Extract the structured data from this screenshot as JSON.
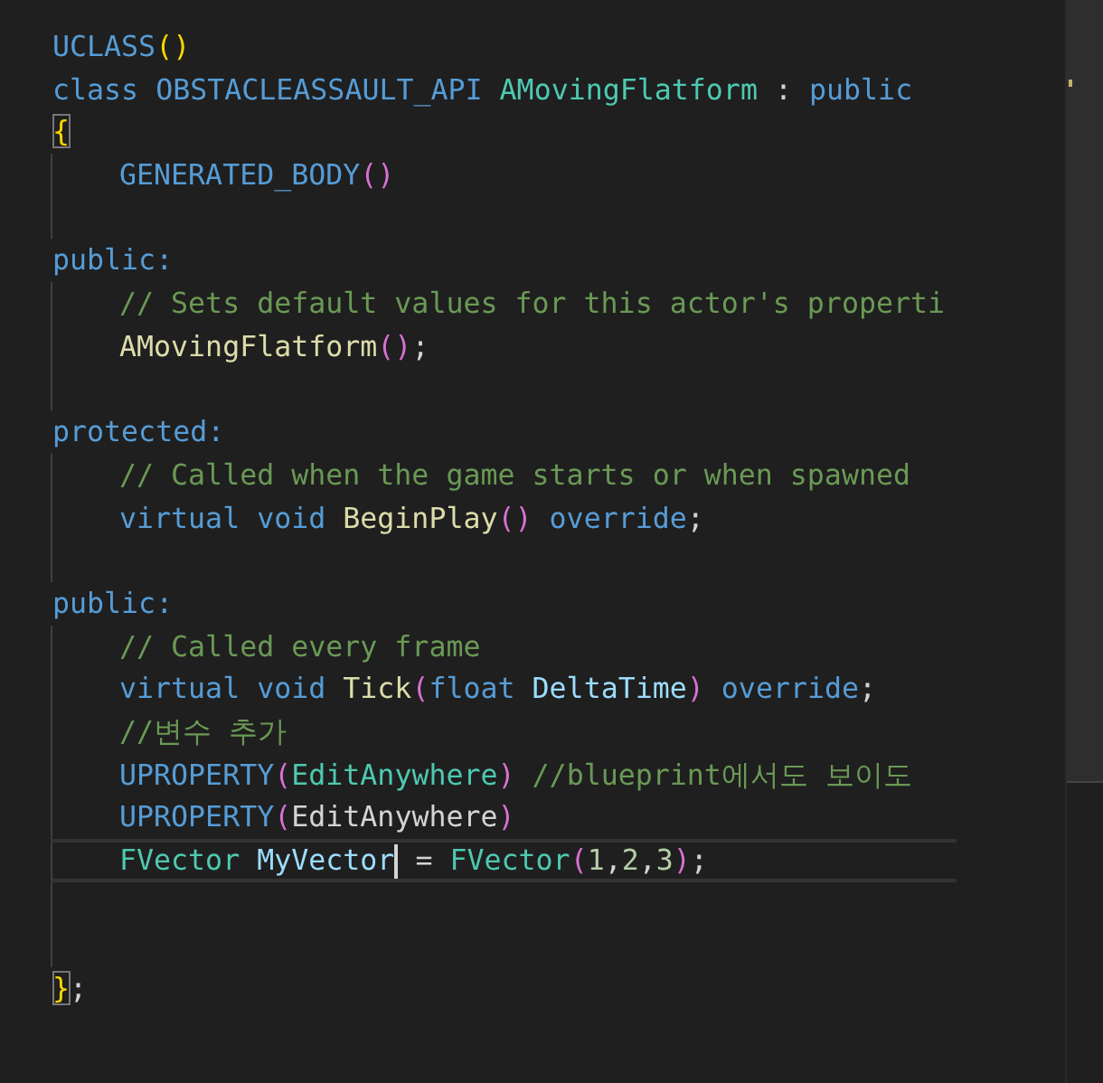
{
  "editor": {
    "lines": [
      {
        "in_block": false,
        "indented": false,
        "current": false,
        "tokens": [
          {
            "kind": "macro",
            "text": "UCLASS"
          },
          {
            "kind": "paren1",
            "text": "()"
          }
        ]
      },
      {
        "in_block": false,
        "indented": false,
        "current": false,
        "tokens": [
          {
            "kind": "keyword",
            "text": "class "
          },
          {
            "kind": "macro",
            "text": "OBSTACLEASSAULT_API "
          },
          {
            "kind": "type",
            "text": "AMovingFlatform"
          },
          {
            "kind": "plain",
            "text": " : "
          },
          {
            "kind": "keyword",
            "text": "public"
          }
        ]
      },
      {
        "in_block": false,
        "indented": false,
        "current": false,
        "tokens": [
          {
            "kind": "brace_match",
            "text": "{"
          }
        ]
      },
      {
        "in_block": true,
        "indented": true,
        "current": false,
        "tokens": [
          {
            "kind": "macro",
            "text": "GENERATED_BODY"
          },
          {
            "kind": "paren2",
            "text": "()"
          }
        ]
      },
      {
        "in_block": true,
        "indented": false,
        "current": false
      },
      {
        "in_block": false,
        "indented": false,
        "current": false,
        "tokens": [
          {
            "kind": "keyword",
            "text": "public:"
          }
        ]
      },
      {
        "in_block": true,
        "indented": true,
        "current": false,
        "tokens": [
          {
            "kind": "comment",
            "text": "// Sets default values for this actor's properti"
          }
        ]
      },
      {
        "in_block": true,
        "indented": true,
        "current": false,
        "tokens": [
          {
            "kind": "function",
            "text": "AMovingFlatform"
          },
          {
            "kind": "paren2",
            "text": "()"
          },
          {
            "kind": "plain",
            "text": ";"
          }
        ]
      },
      {
        "in_block": true,
        "indented": false,
        "current": false
      },
      {
        "in_block": false,
        "indented": false,
        "current": false,
        "tokens": [
          {
            "kind": "keyword",
            "text": "protected:"
          }
        ]
      },
      {
        "in_block": true,
        "indented": true,
        "current": false,
        "tokens": [
          {
            "kind": "comment",
            "text": "// Called when the game starts or when spawned"
          }
        ]
      },
      {
        "in_block": true,
        "indented": true,
        "current": false,
        "tokens": [
          {
            "kind": "keyword",
            "text": "virtual void "
          },
          {
            "kind": "function",
            "text": "BeginPlay"
          },
          {
            "kind": "paren2",
            "text": "()"
          },
          {
            "kind": "keyword",
            "text": " override"
          },
          {
            "kind": "plain",
            "text": ";"
          }
        ]
      },
      {
        "in_block": true,
        "indented": false,
        "current": false
      },
      {
        "in_block": false,
        "indented": false,
        "current": false,
        "tokens": [
          {
            "kind": "keyword",
            "text": "public:"
          }
        ]
      },
      {
        "in_block": true,
        "indented": true,
        "current": false,
        "tokens": [
          {
            "kind": "comment",
            "text": "// Called every frame"
          }
        ]
      },
      {
        "in_block": true,
        "indented": true,
        "current": false,
        "tokens": [
          {
            "kind": "keyword",
            "text": "virtual void "
          },
          {
            "kind": "function",
            "text": "Tick"
          },
          {
            "kind": "paren2",
            "text": "("
          },
          {
            "kind": "keyword",
            "text": "float "
          },
          {
            "kind": "param",
            "text": "DeltaTime"
          },
          {
            "kind": "paren2",
            "text": ")"
          },
          {
            "kind": "keyword",
            "text": " override"
          },
          {
            "kind": "plain",
            "text": ";"
          }
        ]
      },
      {
        "in_block": true,
        "indented": true,
        "current": false,
        "tokens": [
          {
            "kind": "comment",
            "text": "//변수 추가"
          }
        ]
      },
      {
        "in_block": true,
        "indented": true,
        "current": false,
        "tokens": [
          {
            "kind": "macro",
            "text": "UPROPERTY"
          },
          {
            "kind": "paren2",
            "text": "("
          },
          {
            "kind": "type",
            "text": "EditAnywhere"
          },
          {
            "kind": "paren2",
            "text": ")"
          },
          {
            "kind": "comment",
            "text": " //blueprint에서도 보이도"
          }
        ]
      },
      {
        "in_block": true,
        "indented": true,
        "current": false,
        "tokens": [
          {
            "kind": "macro",
            "text": "UPROPERTY"
          },
          {
            "kind": "paren2",
            "text": "("
          },
          {
            "kind": "plain",
            "text": "EditAnywhere"
          },
          {
            "kind": "paren2",
            "text": ")"
          }
        ]
      },
      {
        "in_block": true,
        "indented": true,
        "current": true,
        "tokens": [
          {
            "kind": "type",
            "text": "FVector "
          },
          {
            "kind": "param",
            "text": "MyVector"
          },
          {
            "kind": "caret"
          },
          {
            "kind": "plain",
            "text": " = "
          },
          {
            "kind": "type",
            "text": "FVector"
          },
          {
            "kind": "paren2",
            "text": "("
          },
          {
            "kind": "number",
            "text": "1"
          },
          {
            "kind": "plain",
            "text": ","
          },
          {
            "kind": "number",
            "text": "2"
          },
          {
            "kind": "plain",
            "text": ","
          },
          {
            "kind": "number",
            "text": "3"
          },
          {
            "kind": "paren2",
            "text": ")"
          },
          {
            "kind": "plain",
            "text": ";"
          }
        ]
      },
      {
        "in_block": true,
        "indented": false,
        "current": false
      },
      {
        "in_block": true,
        "indented": false,
        "current": false
      },
      {
        "in_block": false,
        "indented": false,
        "current": false,
        "tokens": [
          {
            "kind": "brace_match",
            "text": "}"
          },
          {
            "kind": "plain",
            "text": ";"
          }
        ]
      }
    ]
  }
}
